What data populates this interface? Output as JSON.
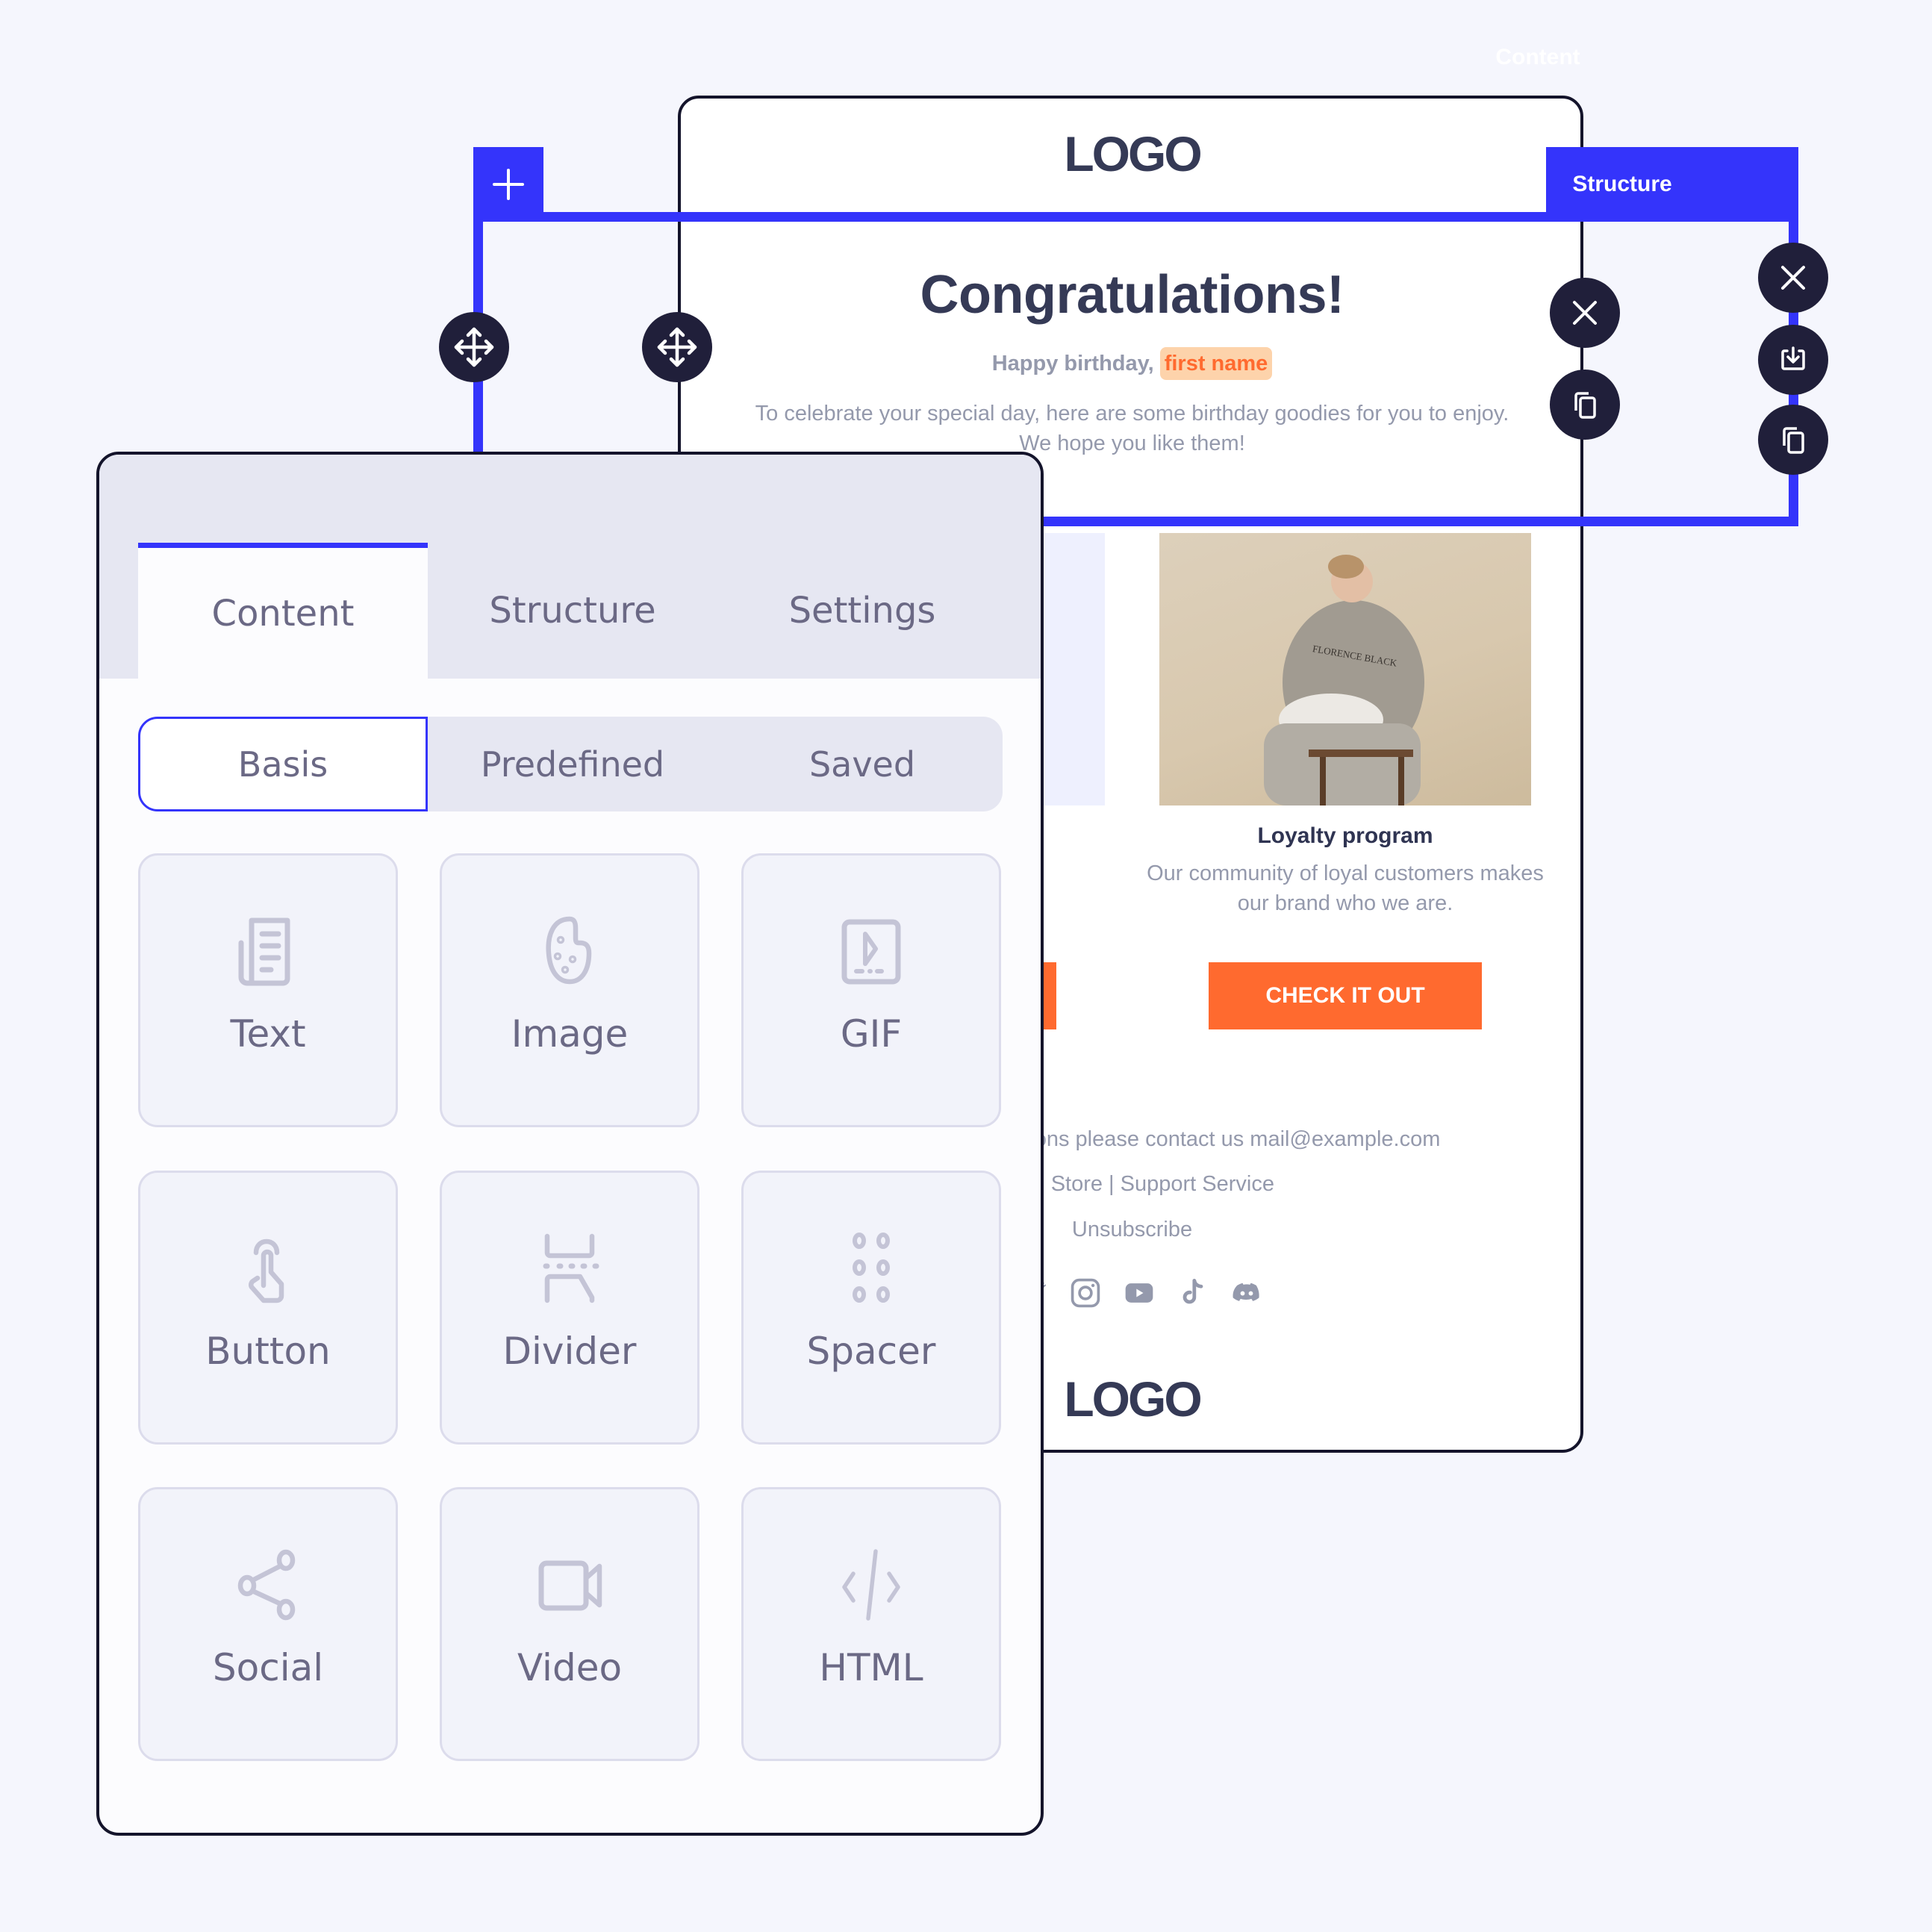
{
  "ghost_label": "Content",
  "email": {
    "logo_top": "LOGO",
    "heading": "Congratulations!",
    "greeting": "Happy birthday,",
    "merge_tag": "first name",
    "intro": "To celebrate your special day, here are some birthday goodies for you to enjoy. We hope you like them!",
    "photo_alt": "Woman in grey FLORENCE BLACK sweatshirt sitting on a chair",
    "loyalty_title": "Loyalty program",
    "loyalty_desc": "Our community of loyal customers makes our brand who we are.",
    "cta_label": "CHECK IT OUT",
    "footer_contact": "If you have any questions please contact us mail@example.com",
    "footer_links": "Blog | Store | Support Service",
    "footer_unsubscribe": "Unsubscribe",
    "socials": [
      "twitter-icon",
      "instagram-icon",
      "youtube-icon",
      "tiktok-icon",
      "discord-icon"
    ],
    "logo_bottom": "LOGO"
  },
  "selection": {
    "tag_label": "Structure",
    "add_icon": "plus-icon",
    "row_actions": [
      "close-icon",
      "copy-icon"
    ],
    "structure_actions": [
      "close-icon",
      "save-icon",
      "copy-icon"
    ]
  },
  "panel": {
    "tabs": [
      {
        "label": "Content",
        "active": true
      },
      {
        "label": "Structure",
        "active": false
      },
      {
        "label": "Settings",
        "active": false
      }
    ],
    "segments": [
      {
        "label": "Basis",
        "active": true
      },
      {
        "label": "Predefined",
        "active": false
      },
      {
        "label": "Saved",
        "active": false
      }
    ],
    "blocks": [
      {
        "label": "Text",
        "icon": "text-document-icon"
      },
      {
        "label": "Image",
        "icon": "palette-icon"
      },
      {
        "label": "GIF",
        "icon": "gif-play-icon"
      },
      {
        "label": "Button",
        "icon": "tap-finger-icon"
      },
      {
        "label": "Divider",
        "icon": "divider-icon"
      },
      {
        "label": "Spacer",
        "icon": "spacer-dots-icon"
      },
      {
        "label": "Social",
        "icon": "share-icon"
      },
      {
        "label": "Video",
        "icon": "video-camera-icon"
      },
      {
        "label": "HTML",
        "icon": "code-icon"
      }
    ]
  },
  "colors": {
    "accent": "#3434fb",
    "dark": "#201f3a",
    "cta": "#ff6a2f",
    "merge_tag_bg": "#fdd3ab",
    "text_muted": "#9499ac",
    "heading": "#353a56"
  }
}
